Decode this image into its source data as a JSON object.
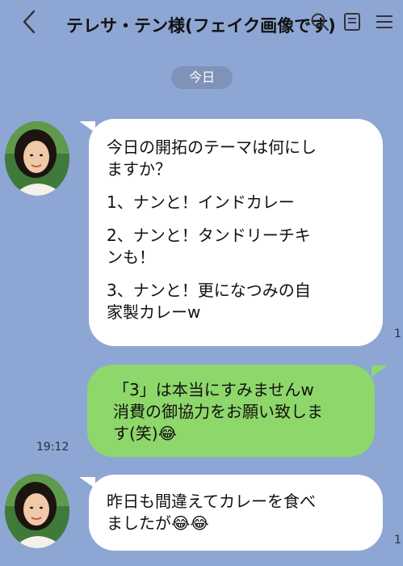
{
  "header": {
    "title": "テレサ・テン様(フェイク画像です)",
    "back_icon": "chevron-left-icon",
    "icons": [
      "search-icon",
      "notes-icon",
      "menu-icon"
    ]
  },
  "date_label": "今日",
  "messages": [
    {
      "sender": "friend",
      "paragraphs": [
        [
          "今日の開拓のテーマは何にし",
          "ますか？"
        ],
        [
          "1、ナンと！インドカレー"
        ],
        [
          "2、ナンと！タンドリーチキ",
          "ンも！"
        ],
        [
          "3、ナンと！更になつみの自",
          "家製カレーw"
        ]
      ],
      "time": "1"
    },
    {
      "sender": "me",
      "lines": [
        "「3」は本当にすみませんw",
        "消費の御協力をお願い致しま",
        "す(笑)😂"
      ],
      "time": "19:12"
    },
    {
      "sender": "friend",
      "lines": [
        "昨日も間違えてカレーを食べ",
        "ましたが😂😂"
      ],
      "time": "1"
    }
  ],
  "colors": {
    "background": "#8ea6d4",
    "friend_bubble": "#ffffff",
    "my_bubble": "#8ed76a",
    "date_pill": "#7f92b8"
  }
}
